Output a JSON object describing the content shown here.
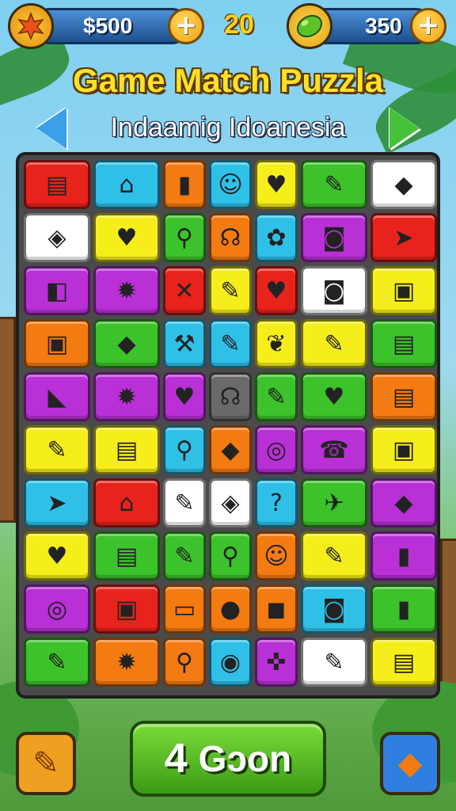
{
  "hud": {
    "coins": "$500",
    "coins_plus": "+",
    "level": "20",
    "gems": "350",
    "gems_plus": "+",
    "left_icon": "sun-badge-icon",
    "right_icon": "green-gem-icon"
  },
  "title": "Game Match Puzzla",
  "subtitle": "Indaamig Idoanesia",
  "nav": {
    "prev_icon": "arrow-left-icon",
    "next_icon": "arrow-right-icon"
  },
  "board": {
    "rows": [
      [
        {
          "color": "#e8231c",
          "glyph": "▤",
          "icon": "box-icon"
        },
        {
          "color": "#2fc0e8",
          "glyph": "⌂",
          "icon": "house-icon"
        },
        {
          "color": "#f47a12",
          "glyph": "▮",
          "icon": "book-icon"
        },
        {
          "color": "#2fc0e8",
          "glyph": "☺",
          "icon": "face-icon"
        },
        {
          "color": "#f6ee1a",
          "glyph": "♥",
          "icon": "heart-icon"
        },
        {
          "color": "#3cc22a",
          "glyph": "✎",
          "icon": "pencil-icon"
        },
        {
          "color": "#ffffff",
          "glyph": "◆",
          "icon": "box-icon"
        }
      ],
      [
        {
          "color": "#ffffff",
          "glyph": "◈",
          "icon": "box-icon"
        },
        {
          "color": "#f6ee1a",
          "glyph": "♥",
          "icon": "heart-icon"
        },
        {
          "color": "#3cc22a",
          "glyph": "⚲",
          "icon": "magnifier-icon"
        },
        {
          "color": "#f47a12",
          "glyph": "☊",
          "icon": "blob-icon"
        },
        {
          "color": "#2fc0e8",
          "glyph": "✿",
          "icon": "flower-icon"
        },
        {
          "color": "#b830d6",
          "glyph": "◙",
          "icon": "camera-icon"
        },
        {
          "color": "#e8231c",
          "glyph": "➤",
          "icon": "arrow-icon"
        }
      ],
      [
        {
          "color": "#b830d6",
          "glyph": "◧",
          "icon": "cube-icon"
        },
        {
          "color": "#b830d6",
          "glyph": "✹",
          "icon": "flower-icon"
        },
        {
          "color": "#e8231c",
          "glyph": "✕",
          "icon": "cross-icon"
        },
        {
          "color": "#f6ee1a",
          "glyph": "✎",
          "icon": "pencil-icon"
        },
        {
          "color": "#e8231c",
          "glyph": "♥",
          "icon": "heart-icon"
        },
        {
          "color": "#ffffff",
          "glyph": "◙",
          "icon": "camera-icon"
        },
        {
          "color": "#f6ee1a",
          "glyph": "▣",
          "icon": "box-icon"
        }
      ],
      [
        {
          "color": "#f47a12",
          "glyph": "▣",
          "icon": "cube-icon"
        },
        {
          "color": "#3cc22a",
          "glyph": "◆",
          "icon": "eraser-icon"
        },
        {
          "color": "#2fc0e8",
          "glyph": "⚒",
          "icon": "hammer-icon"
        },
        {
          "color": "#2fc0e8",
          "glyph": "✎",
          "icon": "pencil-icon"
        },
        {
          "color": "#f6ee1a",
          "glyph": "❦",
          "icon": "leaf-icon"
        },
        {
          "color": "#f6ee1a",
          "glyph": "✎",
          "icon": "pencil-icon"
        },
        {
          "color": "#3cc22a",
          "glyph": "▤",
          "icon": "note-icon"
        }
      ],
      [
        {
          "color": "#b830d6",
          "glyph": "◣",
          "icon": "cube-icon"
        },
        {
          "color": "#b830d6",
          "glyph": "✹",
          "icon": "gear-icon"
        },
        {
          "color": "#b830d6",
          "glyph": "♥",
          "icon": "heart-icon"
        },
        {
          "color": "#6a6a6a",
          "glyph": "☊",
          "icon": "blob-icon"
        },
        {
          "color": "#3cc22a",
          "glyph": "✎",
          "icon": "pen-icon"
        },
        {
          "color": "#3cc22a",
          "glyph": "♥",
          "icon": "heart-icon"
        },
        {
          "color": "#f47a12",
          "glyph": "▤",
          "icon": "folder-icon"
        }
      ],
      [
        {
          "color": "#f6ee1a",
          "glyph": "✎",
          "icon": "pencil-icon"
        },
        {
          "color": "#f6ee1a",
          "glyph": "▤",
          "icon": "note-icon"
        },
        {
          "color": "#2fc0e8",
          "glyph": "⚲",
          "icon": "magnifier-icon"
        },
        {
          "color": "#f47a12",
          "glyph": "◆",
          "icon": "crayon-icon"
        },
        {
          "color": "#b830d6",
          "glyph": "◎",
          "icon": "spiral-icon"
        },
        {
          "color": "#b830d6",
          "glyph": "☎",
          "icon": "phone-icon"
        },
        {
          "color": "#f6ee1a",
          "glyph": "▣",
          "icon": "box-icon"
        }
      ],
      [
        {
          "color": "#2fc0e8",
          "glyph": "➤",
          "icon": "arrow-icon"
        },
        {
          "color": "#e8231c",
          "glyph": "⌂",
          "icon": "house-icon"
        },
        {
          "color": "#ffffff",
          "glyph": "✎",
          "icon": "pencil-icon"
        },
        {
          "color": "#ffffff",
          "glyph": "◈",
          "icon": "cube-icon"
        },
        {
          "color": "#2fc0e8",
          "glyph": "?",
          "icon": "question-icon"
        },
        {
          "color": "#3cc22a",
          "glyph": "✈",
          "icon": "plane-icon"
        },
        {
          "color": "#b830d6",
          "glyph": "◆",
          "icon": "gem-icon"
        }
      ],
      [
        {
          "color": "#f6ee1a",
          "glyph": "♥",
          "icon": "heart-icon"
        },
        {
          "color": "#3cc22a",
          "glyph": "▤",
          "icon": "eraser-icon"
        },
        {
          "color": "#3cc22a",
          "glyph": "✎",
          "icon": "marker-icon"
        },
        {
          "color": "#3cc22a",
          "glyph": "⚲",
          "icon": "brush-icon"
        },
        {
          "color": "#f47a12",
          "glyph": "☺",
          "icon": "speech-icon"
        },
        {
          "color": "#f6ee1a",
          "glyph": "✎",
          "icon": "tool-icon"
        },
        {
          "color": "#b830d6",
          "glyph": "▮",
          "icon": "jar-icon"
        }
      ],
      [
        {
          "color": "#b830d6",
          "glyph": "◎",
          "icon": "spiral-icon"
        },
        {
          "color": "#e8231c",
          "glyph": "▣",
          "icon": "bag-icon"
        },
        {
          "color": "#f47a12",
          "glyph": "▭",
          "icon": "camera-icon"
        },
        {
          "color": "#f47a12",
          "glyph": "●",
          "icon": "cookie-icon"
        },
        {
          "color": "#f47a12",
          "glyph": "◼",
          "icon": "bag-icon"
        },
        {
          "color": "#2fc0e8",
          "glyph": "◙",
          "icon": "frame-icon"
        },
        {
          "color": "#3cc22a",
          "glyph": "▮",
          "icon": "battery-icon"
        }
      ],
      [
        {
          "color": "#3cc22a",
          "glyph": "✎",
          "icon": "pencil-icon"
        },
        {
          "color": "#f47a12",
          "glyph": "✹",
          "icon": "gear-icon"
        },
        {
          "color": "#f47a12",
          "glyph": "⚲",
          "icon": "magnifier-icon"
        },
        {
          "color": "#2fc0e8",
          "glyph": "◉",
          "icon": "button-icon"
        },
        {
          "color": "#b830d6",
          "glyph": "✜",
          "icon": "pin-icon"
        },
        {
          "color": "#ffffff",
          "glyph": "✎",
          "icon": "pen-icon"
        },
        {
          "color": "#f6ee1a",
          "glyph": "▤",
          "icon": "books-icon"
        }
      ]
    ]
  },
  "bottom": {
    "left_button_icon": "eraser-icon",
    "left_button_color": "#f0a020",
    "go_number": "4",
    "go_label": "Gɔon",
    "right_button_icon": "box-icon",
    "right_button_color": "#2f7fe0"
  }
}
